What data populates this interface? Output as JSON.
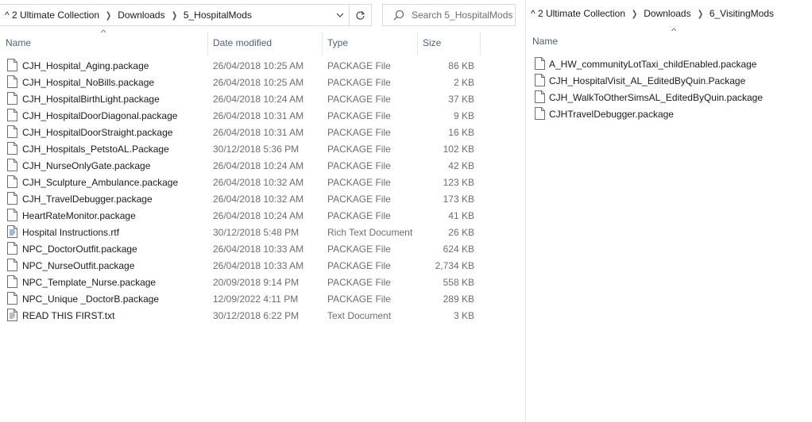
{
  "left_window": {
    "breadcrumbs": [
      "^ 2 Ultimate Collection",
      "Downloads",
      "5_HospitalMods"
    ],
    "search_placeholder": "Search 5_HospitalMods",
    "columns": {
      "name": "Name",
      "date": "Date modified",
      "type": "Type",
      "size": "Size"
    },
    "files": [
      {
        "name": "CJH_Hospital_Aging.package",
        "date": "26/04/2018 10:25 AM",
        "type": "PACKAGE File",
        "size": "86 KB",
        "icon": "file-icon"
      },
      {
        "name": "CJH_Hospital_NoBills.package",
        "date": "26/04/2018 10:25 AM",
        "type": "PACKAGE File",
        "size": "2 KB",
        "icon": "file-icon"
      },
      {
        "name": "CJH_HospitalBirthLight.package",
        "date": "26/04/2018 10:24 AM",
        "type": "PACKAGE File",
        "size": "37 KB",
        "icon": "file-icon"
      },
      {
        "name": "CJH_HospitalDoorDiagonal.package",
        "date": "26/04/2018 10:31 AM",
        "type": "PACKAGE File",
        "size": "9 KB",
        "icon": "file-icon"
      },
      {
        "name": "CJH_HospitalDoorStraight.package",
        "date": "26/04/2018 10:31 AM",
        "type": "PACKAGE File",
        "size": "16 KB",
        "icon": "file-icon"
      },
      {
        "name": "CJH_Hospitals_PetstoAL.Package",
        "date": "30/12/2018 5:36 PM",
        "type": "PACKAGE File",
        "size": "102 KB",
        "icon": "file-icon"
      },
      {
        "name": "CJH_NurseOnlyGate.package",
        "date": "26/04/2018 10:24 AM",
        "type": "PACKAGE File",
        "size": "42 KB",
        "icon": "file-icon"
      },
      {
        "name": "CJH_Sculpture_Ambulance.package",
        "date": "26/04/2018 10:32 AM",
        "type": "PACKAGE File",
        "size": "123 KB",
        "icon": "file-icon"
      },
      {
        "name": "CJH_TravelDebugger.package",
        "date": "26/04/2018 10:32 AM",
        "type": "PACKAGE File",
        "size": "173 KB",
        "icon": "file-icon"
      },
      {
        "name": "HeartRateMonitor.package",
        "date": "26/04/2018 10:24 AM",
        "type": "PACKAGE File",
        "size": "41 KB",
        "icon": "file-icon"
      },
      {
        "name": "Hospital Instructions.rtf",
        "date": "30/12/2018 5:48 PM",
        "type": "Rich Text Document",
        "size": "26 KB",
        "icon": "rtf-file-icon"
      },
      {
        "name": "NPC_DoctorOutfit.package",
        "date": "26/04/2018 10:33 AM",
        "type": "PACKAGE File",
        "size": "624 KB",
        "icon": "file-icon"
      },
      {
        "name": "NPC_NurseOutfit.package",
        "date": "26/04/2018 10:33 AM",
        "type": "PACKAGE File",
        "size": "2,734 KB",
        "icon": "file-icon"
      },
      {
        "name": "NPC_Template_Nurse.package",
        "date": "20/09/2018 9:14 PM",
        "type": "PACKAGE File",
        "size": "558 KB",
        "icon": "file-icon"
      },
      {
        "name": "NPC_Unique _DoctorB.package",
        "date": "12/09/2022 4:11 PM",
        "type": "PACKAGE File",
        "size": "289 KB",
        "icon": "file-icon"
      },
      {
        "name": "READ THIS FIRST.txt",
        "date": "30/12/2018 6:22 PM",
        "type": "Text Document",
        "size": "3 KB",
        "icon": "text-file-icon"
      }
    ]
  },
  "right_window": {
    "breadcrumbs": [
      "^ 2 Ultimate Collection",
      "Downloads",
      "6_VisitingMods"
    ],
    "columns": {
      "name": "Name"
    },
    "files": [
      {
        "name": "A_HW_communityLotTaxi_childEnabled.package",
        "icon": "file-icon"
      },
      {
        "name": "CJH_HospitalVisit_AL_EditedByQuin.Package",
        "icon": "file-icon"
      },
      {
        "name": "CJH_WalkToOtherSimsAL_EditedByQuin.package",
        "icon": "file-icon"
      },
      {
        "name": "CJHTravelDebugger.package",
        "icon": "file-icon"
      }
    ]
  },
  "colors": {
    "header_text": "#4c607a",
    "muted_text": "#6d6d6d",
    "border": "#d9d9d9"
  }
}
